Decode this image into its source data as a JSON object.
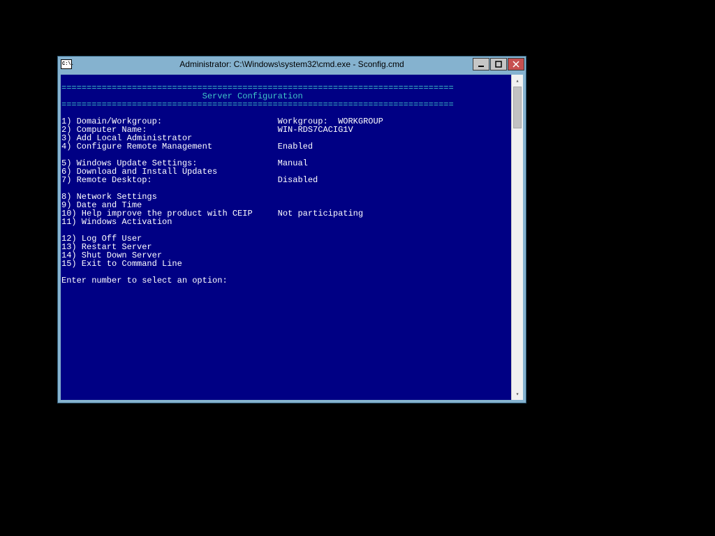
{
  "hbar": "==============================================================================",
  "window": {
    "title": "Administrator: C:\\Windows\\system32\\cmd.exe - Sconfig.cmd",
    "icon_label": "C:\\."
  },
  "banner": {
    "title_padded": "                            Server Configuration"
  },
  "label_col": 43,
  "menu": {
    "group1": [
      {
        "label": "1) Domain/Workgroup:",
        "value": "Workgroup:  WORKGROUP"
      },
      {
        "label": "2) Computer Name:",
        "value": "WIN-RDS7CACIG1V"
      },
      {
        "label": "3) Add Local Administrator",
        "value": ""
      },
      {
        "label": "4) Configure Remote Management",
        "value": "Enabled"
      }
    ],
    "group2": [
      {
        "label": "5) Windows Update Settings:",
        "value": "Manual"
      },
      {
        "label": "6) Download and Install Updates",
        "value": ""
      },
      {
        "label": "7) Remote Desktop:",
        "value": "Disabled"
      }
    ],
    "group3": [
      {
        "label": "8) Network Settings",
        "value": ""
      },
      {
        "label": "9) Date and Time",
        "value": ""
      },
      {
        "label": "10) Help improve the product with CEIP",
        "value": "Not participating"
      },
      {
        "label": "11) Windows Activation",
        "value": ""
      }
    ],
    "group4": [
      {
        "label": "12) Log Off User",
        "value": ""
      },
      {
        "label": "13) Restart Server",
        "value": ""
      },
      {
        "label": "14) Shut Down Server",
        "value": ""
      },
      {
        "label": "15) Exit to Command Line",
        "value": ""
      }
    ]
  },
  "prompt": "Enter number to select an option: "
}
